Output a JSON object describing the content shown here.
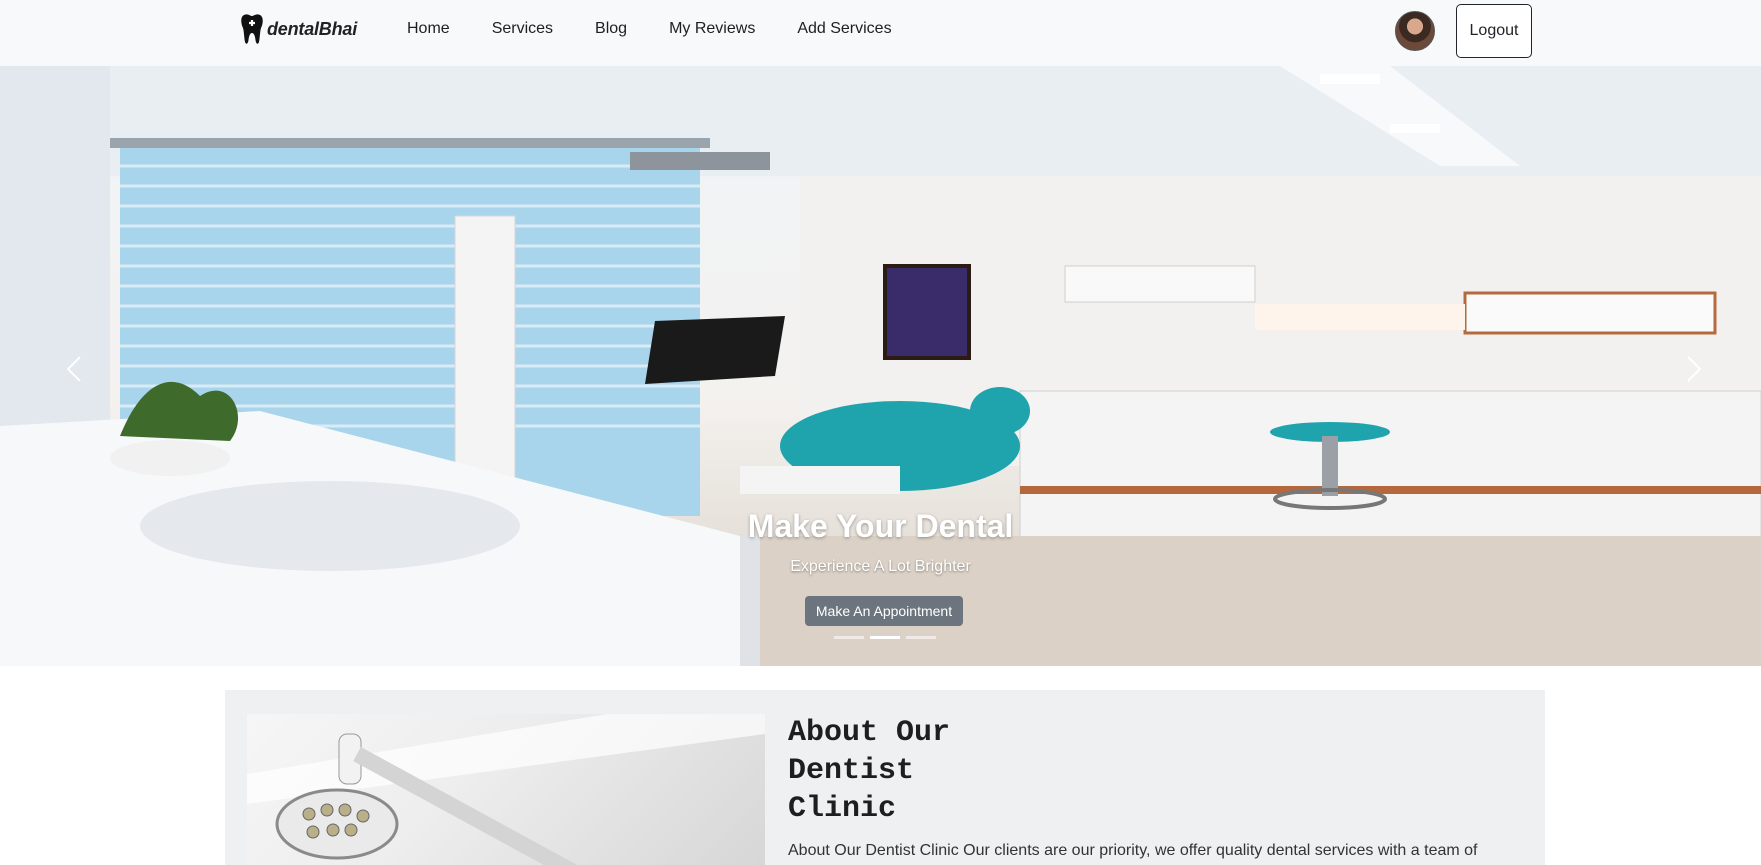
{
  "navbar": {
    "brand": "dentalBhai",
    "links": [
      "Home",
      "Services",
      "Blog",
      "My Reviews",
      "Add Services"
    ],
    "logout_label": "Logout"
  },
  "hero": {
    "title": "Make Your Dental",
    "subtitle": "Experience A Lot Brighter",
    "button_label": "Make An Appointment",
    "slides": 3,
    "active_slide": 2
  },
  "about": {
    "title_lines": [
      "About Our",
      "Dentist",
      "Clinic"
    ],
    "text": "About Our Dentist Clinic Our clients are our priority, we offer quality dental services with a team of"
  },
  "colors": {
    "navbar_bg": "#f8f9fa",
    "button_secondary": "#6c757d",
    "about_bg": "#eff0f1"
  },
  "icons": {
    "brand": "tooth-icon",
    "prev": "chevron-left-icon",
    "next": "chevron-right-icon"
  }
}
